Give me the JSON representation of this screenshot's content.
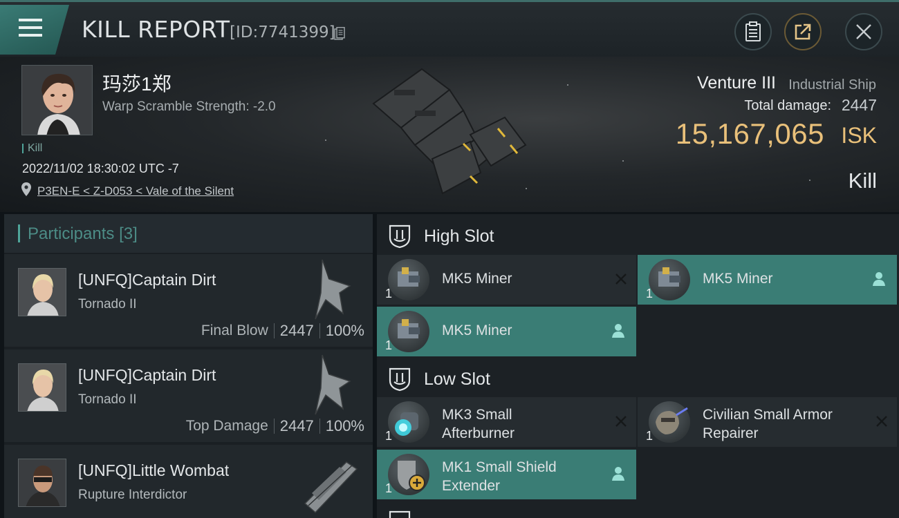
{
  "header": {
    "title": "KILL REPORT",
    "report_id": "[ID:7741399]"
  },
  "victim": {
    "name": "玛莎1郑",
    "warp_scramble": "Warp Scramble Strength: -2.0",
    "tag": "Kill",
    "datetime": "2022/11/02 18:30:02 UTC -7",
    "location": "P3EN-E < Z-D053 < Vale of the Silent"
  },
  "ship": {
    "name": "Venture III",
    "class": "Industrial Ship",
    "total_damage_label": "Total damage:",
    "total_damage": "2447",
    "isk_value": "15,167,065",
    "isk_unit": "ISK",
    "result": "Kill"
  },
  "participants": {
    "label": "Participants",
    "count": "[3]",
    "rows": [
      {
        "name": "[UNFQ]Captain Dirt",
        "ship": "Tornado II",
        "role": "Final Blow",
        "damage": "2447",
        "percent": "100%"
      },
      {
        "name": "[UNFQ]Captain Dirt",
        "ship": "Tornado II",
        "role": "Top Damage",
        "damage": "2447",
        "percent": "100%"
      },
      {
        "name": "[UNFQ]Little Wombat",
        "ship": "Rupture Interdictor",
        "role": "",
        "damage": "",
        "percent": ""
      }
    ]
  },
  "slots": {
    "high": {
      "label": "High Slot",
      "modules": [
        {
          "name": "MK5 Miner",
          "qty": "1",
          "status": "destroyed"
        },
        {
          "name": "MK5 Miner",
          "qty": "1",
          "status": "dropped"
        },
        {
          "name": "MK5 Miner",
          "qty": "1",
          "status": "dropped"
        }
      ]
    },
    "low": {
      "label": "Low Slot",
      "modules": [
        {
          "name_line1": "MK3 Small",
          "name_line2": "Afterburner",
          "qty": "1",
          "status": "destroyed"
        },
        {
          "name_line1": "Civilian Small Armor",
          "name_line2": "Repairer",
          "qty": "1",
          "status": "destroyed"
        },
        {
          "name_line1": "MK1 Small Shield",
          "name_line2": "Extender",
          "qty": "1",
          "status": "dropped"
        }
      ]
    }
  },
  "colors": {
    "accent_teal": "#3a7d75",
    "isk_gold": "#e9c07a",
    "panel_bg": "#22282c"
  }
}
